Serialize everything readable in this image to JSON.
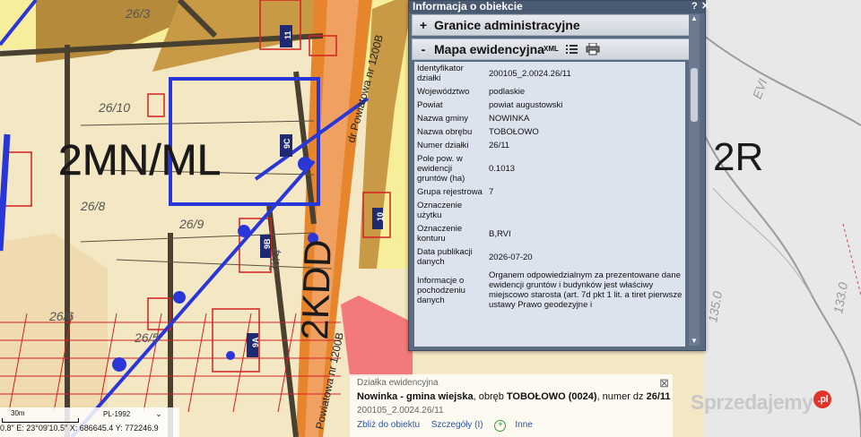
{
  "window": {
    "title": "Informacja o obiekcie",
    "help_glyph": "?",
    "close_glyph": "✕"
  },
  "sections": {
    "granice": {
      "sign": "+",
      "label": "Granice administracyjne"
    },
    "mapa": {
      "sign": "-",
      "label": "Mapa ewidencyjna",
      "xml_label": "XML"
    }
  },
  "attributes": [
    {
      "label": "Identyfikator działki",
      "value": "200105_2.0024.26/11"
    },
    {
      "label": "Województwo",
      "value": "podlaskie"
    },
    {
      "label": "Powiat",
      "value": "powiat augustowski"
    },
    {
      "label": "Nazwa gminy",
      "value": "NOWINKA"
    },
    {
      "label": "Nazwa obrębu",
      "value": "TOBOŁOWO"
    },
    {
      "label": "Numer działki",
      "value": "26/11"
    },
    {
      "label": "Pole pow. w ewidencji gruntów (ha)",
      "value": "0.1013"
    },
    {
      "label": "Grupa rejestrowa",
      "value": "7"
    },
    {
      "label": "Oznaczenie użytku",
      "value": ""
    },
    {
      "label": "Oznaczenie konturu",
      "value": "B,RVI"
    },
    {
      "label": "Data publikacji danych",
      "value": "2026-07-20"
    },
    {
      "label": "Informacje o pochodzeniu danych",
      "value": "Organem odpowiedzialnym za prezentowane dane ewidencji gruntów i budynków jest właściwy miejscowo starosta (art. 7d pkt 1 lit. a tiret pierwsze ustawy Prawo geodezyjne i"
    }
  ],
  "popup": {
    "title": "Działka ewidencyjna",
    "desc_bold1": "Nowinka - gmina wiejska",
    "desc_mid": ", obręb ",
    "desc_bold2": "TOBOŁOWO (0024)",
    "desc_tail": ", numer dz ",
    "desc_bold3": "26/11",
    "parcel_id": "200105_2.0024.26/11",
    "link_zoom": "Zbliż do obiektu",
    "link_details": "Szczegóły (I)",
    "link_more": "Inne",
    "close_glyph": "⊠"
  },
  "status": {
    "scale_label": "30m",
    "crs": "PL-1992",
    "coords": "0.8\"  E: 23°09'10.5\"  X: 686645.4  Y: 772246.9"
  },
  "map_labels": {
    "zone_main": "2MN/ML",
    "zone_right": "2R",
    "zone_road": "2KDD",
    "road_top": "dr Powiatowa nr 1200B",
    "road_bottom": "Powiatowa nr 1200B",
    "parcels": [
      "26/10",
      "26/8",
      "26/9",
      "26/4",
      "26/6",
      "26/5",
      "26/3",
      "EVI",
      "135.0",
      "133.0"
    ],
    "buildings": [
      "11",
      "10",
      "9A",
      "9B",
      "9C"
    ]
  },
  "watermark": {
    "text": "Sprzedajemy",
    "suffix": ".pl"
  },
  "colors": {
    "zone_yellow": "#f3e7c4",
    "road_orange": "#e6852b",
    "zone_brown": "#b58a3a",
    "pipe_blue": "#2a37d8",
    "parcel_red": "#d42020",
    "panel_bg": "#5b6b82"
  }
}
